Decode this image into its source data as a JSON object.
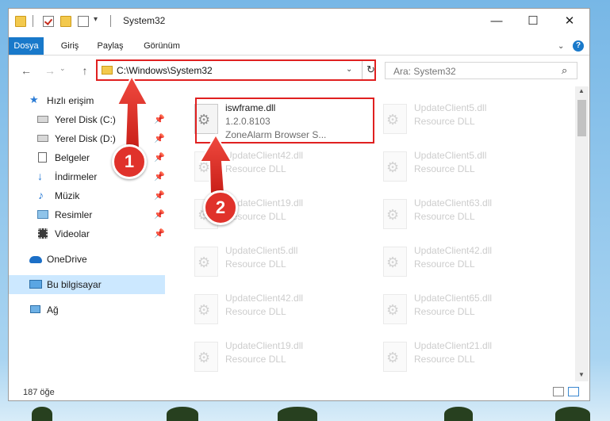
{
  "window": {
    "title": "System32",
    "buttons": {
      "minimize": "—",
      "maximize": "☐",
      "close": "✕"
    }
  },
  "ribbon": {
    "tabs": [
      {
        "label": "Dosya",
        "active": true
      },
      {
        "label": "Giriş",
        "active": false
      },
      {
        "label": "Paylaş",
        "active": false
      },
      {
        "label": "Görünüm",
        "active": false
      }
    ],
    "help_label": "?"
  },
  "navigation": {
    "back": "←",
    "forward": "→",
    "up": "↑",
    "address": "C:\\Windows\\System32",
    "search_placeholder": "Ara: System32"
  },
  "sidebar": {
    "items": [
      {
        "label": "Hızlı erişim",
        "icon": "star-icon"
      },
      {
        "label": "Yerel Disk (C:)",
        "icon": "drive-icon",
        "pinned": true
      },
      {
        "label": "Yerel Disk (D:)",
        "icon": "drive-icon",
        "pinned": true
      },
      {
        "label": "Belgeler",
        "icon": "documents-icon",
        "pinned": true
      },
      {
        "label": "İndirmeler",
        "icon": "download-icon",
        "pinned": true
      },
      {
        "label": "Müzik",
        "icon": "music-icon",
        "pinned": true
      },
      {
        "label": "Resimler",
        "icon": "pictures-icon",
        "pinned": true
      },
      {
        "label": "Videolar",
        "icon": "video-icon",
        "pinned": true
      },
      {
        "label": "OneDrive",
        "icon": "cloud-icon"
      },
      {
        "label": "Bu bilgisayar",
        "icon": "computer-icon",
        "selected": true
      },
      {
        "label": "Ağ",
        "icon": "network-icon"
      }
    ]
  },
  "files": {
    "left": [
      {
        "name": "iswframe.dll",
        "line1": "1.2.0.8103",
        "line2": "ZoneAlarm Browser S...",
        "highlighted": true
      },
      {
        "name": "UpdateClient42.dll",
        "line1": "Resource DLL"
      },
      {
        "name": "UpdateClient19.dll",
        "line1": "Resource DLL"
      },
      {
        "name": "UpdateClient5.dll",
        "line1": "Resource DLL"
      },
      {
        "name": "UpdateClient42.dll",
        "line1": "Resource DLL"
      },
      {
        "name": "UpdateClient19.dll",
        "line1": "Resource DLL"
      }
    ],
    "right": [
      {
        "name": "UpdateClient5.dll",
        "line1": "Resource DLL"
      },
      {
        "name": "UpdateClient5.dll",
        "line1": "Resource DLL"
      },
      {
        "name": "UpdateClient63.dll",
        "line1": "Resource DLL"
      },
      {
        "name": "UpdateClient42.dll",
        "line1": "Resource DLL"
      },
      {
        "name": "UpdateClient65.dll",
        "line1": "Resource DLL"
      },
      {
        "name": "UpdateClient21.dll",
        "line1": "Resource DLL"
      }
    ]
  },
  "status": {
    "item_count": "187 öğe"
  },
  "callouts": [
    {
      "label": "1"
    },
    {
      "label": "2"
    }
  ],
  "colors": {
    "accent": "#1979ca",
    "callout": "#e0322b",
    "highlight": "#e02020",
    "selection": "#cce8ff"
  }
}
